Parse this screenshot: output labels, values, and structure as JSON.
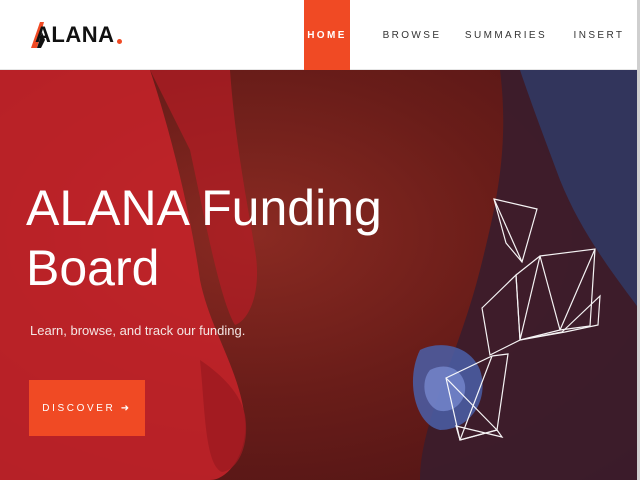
{
  "brand": {
    "name": "ALANA",
    "accent": "#f04a24"
  },
  "nav": {
    "home": "HOME",
    "browse": "BROWSE",
    "summaries": "SUMMARIES",
    "insert": "INSERT"
  },
  "hero": {
    "title": "ALANA Funding Board",
    "subtitle": "Learn, browse, and track our funding.",
    "cta": "DISCOVER ➜"
  }
}
